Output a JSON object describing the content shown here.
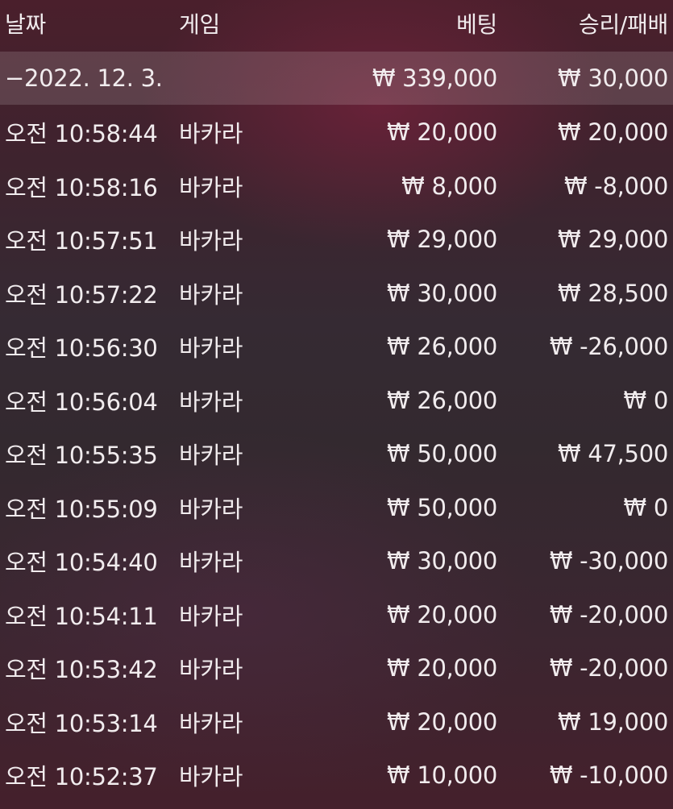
{
  "header": {
    "date": "날짜",
    "game": "게임",
    "bet": "베팅",
    "result": "승리/패배"
  },
  "group": {
    "date": "−2022. 12. 3.",
    "bet": "₩ 339,000",
    "result": "₩ 30,000"
  },
  "rows": [
    {
      "time": "오전 10:58:44",
      "game": "바카라",
      "bet": "₩ 20,000",
      "result": "₩ 20,000"
    },
    {
      "time": "오전 10:58:16",
      "game": "바카라",
      "bet": "₩ 8,000",
      "result": "₩ -8,000"
    },
    {
      "time": "오전 10:57:51",
      "game": "바카라",
      "bet": "₩ 29,000",
      "result": "₩ 29,000"
    },
    {
      "time": "오전 10:57:22",
      "game": "바카라",
      "bet": "₩ 30,000",
      "result": "₩ 28,500"
    },
    {
      "time": "오전 10:56:30",
      "game": "바카라",
      "bet": "₩ 26,000",
      "result": "₩ -26,000"
    },
    {
      "time": "오전 10:56:04",
      "game": "바카라",
      "bet": "₩ 26,000",
      "result": "₩ 0"
    },
    {
      "time": "오전 10:55:35",
      "game": "바카라",
      "bet": "₩ 50,000",
      "result": "₩ 47,500"
    },
    {
      "time": "오전 10:55:09",
      "game": "바카라",
      "bet": "₩ 50,000",
      "result": "₩ 0"
    },
    {
      "time": "오전 10:54:40",
      "game": "바카라",
      "bet": "₩ 30,000",
      "result": "₩ -30,000"
    },
    {
      "time": "오전 10:54:11",
      "game": "바카라",
      "bet": "₩ 20,000",
      "result": "₩ -20,000"
    },
    {
      "time": "오전 10:53:42",
      "game": "바카라",
      "bet": "₩ 20,000",
      "result": "₩ -20,000"
    },
    {
      "time": "오전 10:53:14",
      "game": "바카라",
      "bet": "₩ 20,000",
      "result": "₩ 19,000"
    },
    {
      "time": "오전 10:52:37",
      "game": "바카라",
      "bet": "₩ 10,000",
      "result": "₩ -10,000"
    }
  ]
}
